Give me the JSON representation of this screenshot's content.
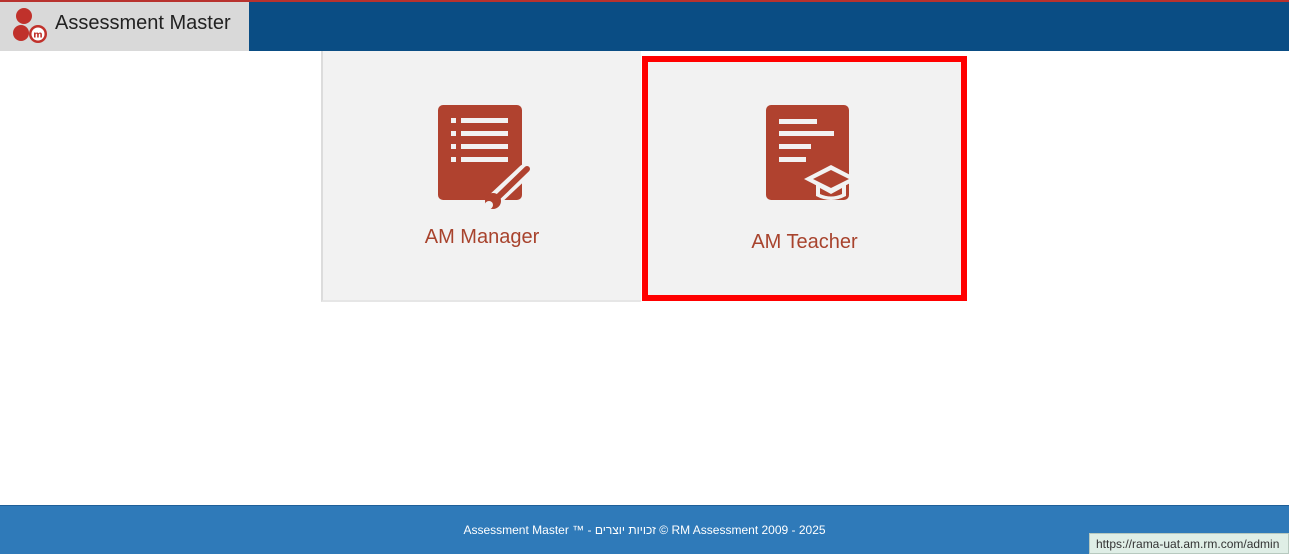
{
  "app": {
    "title": "Assessment Master",
    "logo_icon": "rm-logo-icon"
  },
  "colors": {
    "header_bg": "#0a4d84",
    "brand_bg": "#d9d9d9",
    "tile_bg": "#f2f2f2",
    "tile_accent": "#b0422f",
    "highlight_border": "#ff0000",
    "footer_bg": "#2f7ab9"
  },
  "tiles": [
    {
      "label": "AM Manager",
      "icon": "document-wrench-icon"
    },
    {
      "label": "AM Teacher",
      "icon": "document-graduation-cap-icon"
    }
  ],
  "footer": {
    "text": "Assessment Master ™ - זכויות יוצרים © RM Assessment 2009 - 2025"
  },
  "status_bar": {
    "url": "https://rama-uat.am.rm.com/admin"
  }
}
